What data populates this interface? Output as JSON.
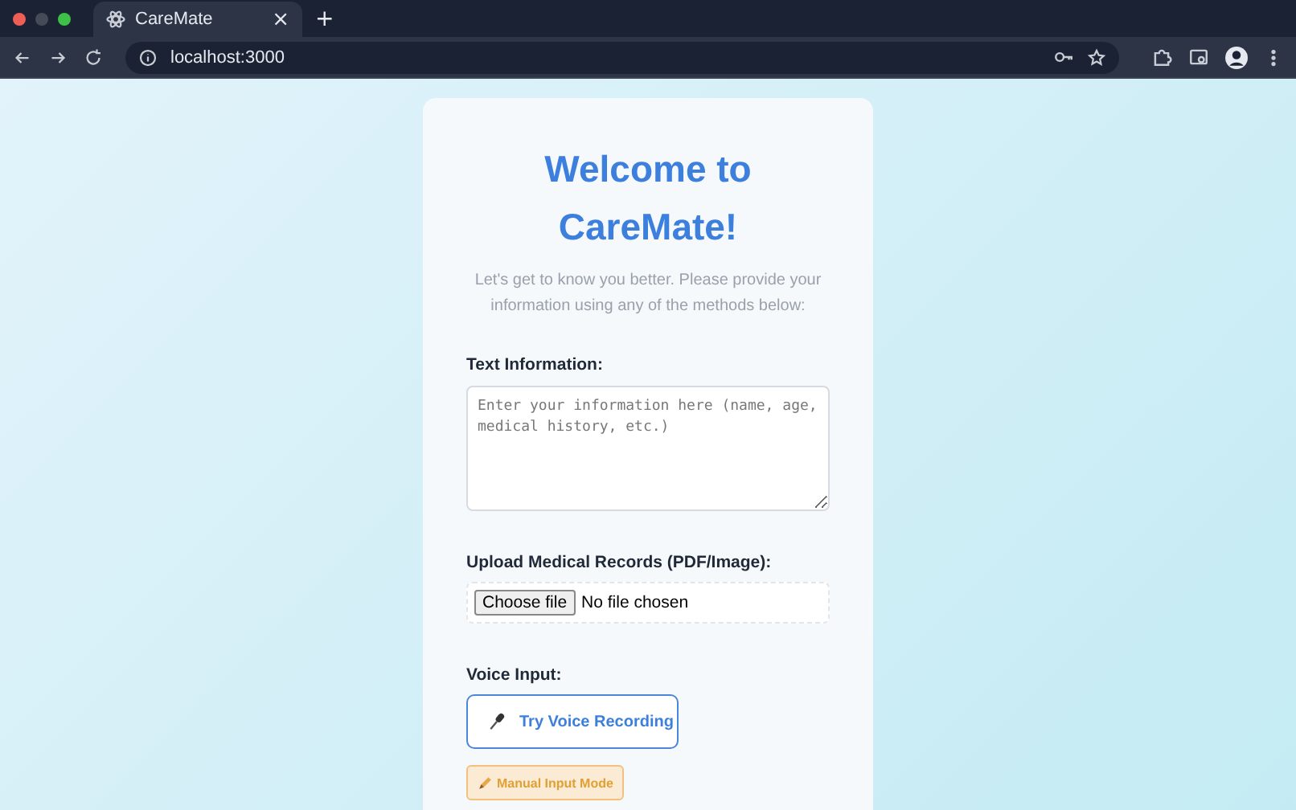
{
  "browser": {
    "tab": {
      "title": "CareMate",
      "close": "×",
      "selected": true
    },
    "new_tab": "+",
    "address": "localhost:3000"
  },
  "card": {
    "title": "Welcome to CareMate!",
    "subtitle": "Let's get to know you better. Please provide your information using any of the methods below:",
    "text_section": {
      "label": "Text Information:",
      "placeholder": "Enter your information here (name, age, medical history, etc.)"
    },
    "upload_section": {
      "label": "Upload Medical Records (PDF/Image):",
      "button": "Choose file",
      "status": "No file chosen"
    },
    "voice_section": {
      "label": "Voice Input:",
      "record_button": "Try Voice Recording",
      "manual_button": "Manual Input Mode"
    }
  }
}
